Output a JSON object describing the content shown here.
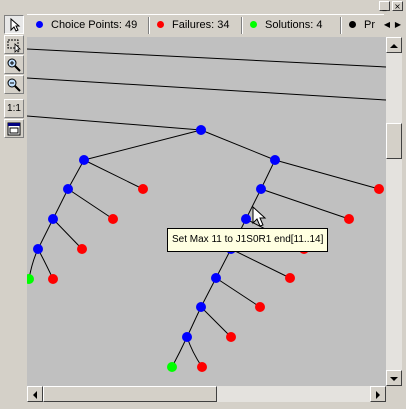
{
  "legend": {
    "items": [
      {
        "label": "Choice Points: 49",
        "color": "#0000ff"
      },
      {
        "label": "Failures: 34",
        "color": "#ff0000"
      },
      {
        "label": "Solutions: 4",
        "color": "#00ff00"
      },
      {
        "label": "Pr",
        "color": "#000000"
      }
    ]
  },
  "toolbar": {
    "zoom_reset_label": "1:1",
    "tools": [
      "pointer-icon",
      "select-rect-icon",
      "zoom-in-icon",
      "zoom-out-icon",
      "zoom-reset",
      "fit-window-icon"
    ]
  },
  "tooltip": {
    "text": "Set Max 11 to J1S0R1 end[11..14]"
  },
  "colors": {
    "choice": "#0000ff",
    "failure": "#ff0000",
    "solution": "#00ff00",
    "background": "#c0c0c0"
  }
}
